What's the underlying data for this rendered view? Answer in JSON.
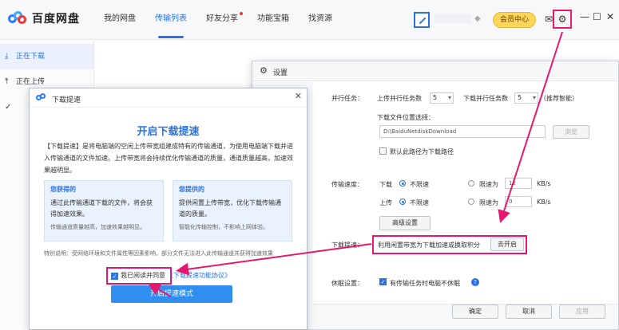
{
  "app": {
    "name": "百度网盘"
  },
  "nav": [
    "我的网盘",
    "传输列表",
    "好友分享",
    "功能宝箱",
    "找资源"
  ],
  "header": {
    "vip_label": "会员中心"
  },
  "sidebar": {
    "items": [
      {
        "label": "正在下载"
      },
      {
        "label": "正在上传"
      }
    ]
  },
  "settings": {
    "title": "设置",
    "parallel_label": "并行任务：",
    "upload_parallel_label": "上传并行任务数",
    "upload_parallel_value": "5",
    "download_parallel_label": "下载并行任务数",
    "download_parallel_value": "5",
    "recommend_note": "（推荐智能）",
    "download_path_label": "下载文件位置选择：",
    "download_path_value": "D:\\BaiduNetdiskDownload",
    "browse_label": "浏览",
    "default_path_label": "默认此路径为下载路径",
    "speed_label": "传输速度：",
    "download_label": "下载",
    "upload_label": "上传",
    "unlimited_label": "不限速",
    "limit_label": "限速为",
    "download_limit_value": "12",
    "upload_limit_value": "0",
    "unit": "KB/s",
    "advanced_label": "高级设置",
    "boost_label": "下载提速：",
    "boost_desc": "利用闲置带宽为下载加速或换取积分",
    "boost_button": "去开启",
    "sleep_label": "休眠设置：",
    "sleep_desc": "有传输任务时电脑不休眠",
    "ok_label": "确定",
    "cancel_label": "取消",
    "apply_label": "应用"
  },
  "accel": {
    "header_title": "下载提速",
    "title": "开启下载提速",
    "description": "【下载提速】是将电脑端的空闲上传带宽组建成特有的传输通道，为使用电脑端下载并进入传输通道的文件加速。上传带宽将会持续优化传输通道的质量，通道质量越高，加速效果越明显。",
    "card_get": {
      "title": "您获得的",
      "body": "通过此传输通道下载的文件，将会获得加速效果。",
      "foot": "传输通道质量越高，加速效果越明显。"
    },
    "card_give": {
      "title": "您提供的",
      "body": "提供闲置上传带宽，优化下载传输通道的质量。",
      "foot": "智能化传输控制，不影响上网体验。"
    },
    "note": "特别说明：受网络环境和文件属性等因素影响，部分文件无法进入此传输通道并获得加速效果",
    "agree_label": "我已阅读并同意",
    "agree_link": "《下载提速功能协议》",
    "open_button": "开启提速模式"
  }
}
